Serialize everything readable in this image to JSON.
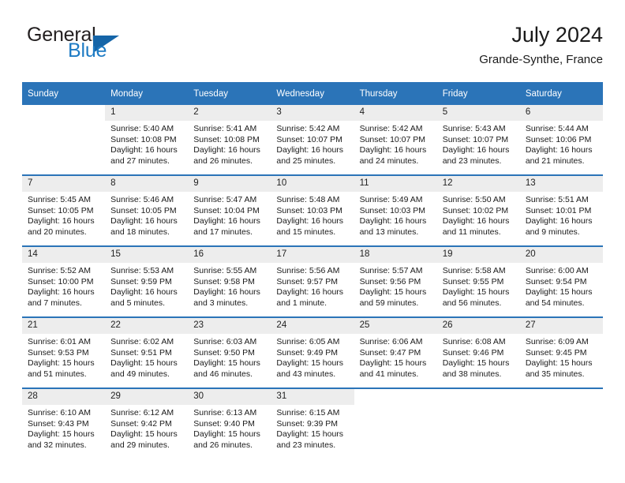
{
  "brand": {
    "name_part1": "General",
    "name_part2": "Blue",
    "flag_icon": "flag-icon",
    "accent_color": "#1e7bc4"
  },
  "header": {
    "title": "July 2024",
    "location": "Grande-Synthe, France"
  },
  "theme": {
    "header_blue": "#2b74b8",
    "daynum_gray": "#ededed",
    "text_color": "#1a1a1a"
  },
  "calendar": {
    "weekday_headers": [
      "Sunday",
      "Monday",
      "Tuesday",
      "Wednesday",
      "Thursday",
      "Friday",
      "Saturday"
    ],
    "weeks": [
      [
        {
          "day": "",
          "details": ""
        },
        {
          "day": "1",
          "details": "Sunrise: 5:40 AM\nSunset: 10:08 PM\nDaylight: 16 hours and 27 minutes."
        },
        {
          "day": "2",
          "details": "Sunrise: 5:41 AM\nSunset: 10:08 PM\nDaylight: 16 hours and 26 minutes."
        },
        {
          "day": "3",
          "details": "Sunrise: 5:42 AM\nSunset: 10:07 PM\nDaylight: 16 hours and 25 minutes."
        },
        {
          "day": "4",
          "details": "Sunrise: 5:42 AM\nSunset: 10:07 PM\nDaylight: 16 hours and 24 minutes."
        },
        {
          "day": "5",
          "details": "Sunrise: 5:43 AM\nSunset: 10:07 PM\nDaylight: 16 hours and 23 minutes."
        },
        {
          "day": "6",
          "details": "Sunrise: 5:44 AM\nSunset: 10:06 PM\nDaylight: 16 hours and 21 minutes."
        }
      ],
      [
        {
          "day": "7",
          "details": "Sunrise: 5:45 AM\nSunset: 10:05 PM\nDaylight: 16 hours and 20 minutes."
        },
        {
          "day": "8",
          "details": "Sunrise: 5:46 AM\nSunset: 10:05 PM\nDaylight: 16 hours and 18 minutes."
        },
        {
          "day": "9",
          "details": "Sunrise: 5:47 AM\nSunset: 10:04 PM\nDaylight: 16 hours and 17 minutes."
        },
        {
          "day": "10",
          "details": "Sunrise: 5:48 AM\nSunset: 10:03 PM\nDaylight: 16 hours and 15 minutes."
        },
        {
          "day": "11",
          "details": "Sunrise: 5:49 AM\nSunset: 10:03 PM\nDaylight: 16 hours and 13 minutes."
        },
        {
          "day": "12",
          "details": "Sunrise: 5:50 AM\nSunset: 10:02 PM\nDaylight: 16 hours and 11 minutes."
        },
        {
          "day": "13",
          "details": "Sunrise: 5:51 AM\nSunset: 10:01 PM\nDaylight: 16 hours and 9 minutes."
        }
      ],
      [
        {
          "day": "14",
          "details": "Sunrise: 5:52 AM\nSunset: 10:00 PM\nDaylight: 16 hours and 7 minutes."
        },
        {
          "day": "15",
          "details": "Sunrise: 5:53 AM\nSunset: 9:59 PM\nDaylight: 16 hours and 5 minutes."
        },
        {
          "day": "16",
          "details": "Sunrise: 5:55 AM\nSunset: 9:58 PM\nDaylight: 16 hours and 3 minutes."
        },
        {
          "day": "17",
          "details": "Sunrise: 5:56 AM\nSunset: 9:57 PM\nDaylight: 16 hours and 1 minute."
        },
        {
          "day": "18",
          "details": "Sunrise: 5:57 AM\nSunset: 9:56 PM\nDaylight: 15 hours and 59 minutes."
        },
        {
          "day": "19",
          "details": "Sunrise: 5:58 AM\nSunset: 9:55 PM\nDaylight: 15 hours and 56 minutes."
        },
        {
          "day": "20",
          "details": "Sunrise: 6:00 AM\nSunset: 9:54 PM\nDaylight: 15 hours and 54 minutes."
        }
      ],
      [
        {
          "day": "21",
          "details": "Sunrise: 6:01 AM\nSunset: 9:53 PM\nDaylight: 15 hours and 51 minutes."
        },
        {
          "day": "22",
          "details": "Sunrise: 6:02 AM\nSunset: 9:51 PM\nDaylight: 15 hours and 49 minutes."
        },
        {
          "day": "23",
          "details": "Sunrise: 6:03 AM\nSunset: 9:50 PM\nDaylight: 15 hours and 46 minutes."
        },
        {
          "day": "24",
          "details": "Sunrise: 6:05 AM\nSunset: 9:49 PM\nDaylight: 15 hours and 43 minutes."
        },
        {
          "day": "25",
          "details": "Sunrise: 6:06 AM\nSunset: 9:47 PM\nDaylight: 15 hours and 41 minutes."
        },
        {
          "day": "26",
          "details": "Sunrise: 6:08 AM\nSunset: 9:46 PM\nDaylight: 15 hours and 38 minutes."
        },
        {
          "day": "27",
          "details": "Sunrise: 6:09 AM\nSunset: 9:45 PM\nDaylight: 15 hours and 35 minutes."
        }
      ],
      [
        {
          "day": "28",
          "details": "Sunrise: 6:10 AM\nSunset: 9:43 PM\nDaylight: 15 hours and 32 minutes."
        },
        {
          "day": "29",
          "details": "Sunrise: 6:12 AM\nSunset: 9:42 PM\nDaylight: 15 hours and 29 minutes."
        },
        {
          "day": "30",
          "details": "Sunrise: 6:13 AM\nSunset: 9:40 PM\nDaylight: 15 hours and 26 minutes."
        },
        {
          "day": "31",
          "details": "Sunrise: 6:15 AM\nSunset: 9:39 PM\nDaylight: 15 hours and 23 minutes."
        },
        {
          "day": "",
          "details": ""
        },
        {
          "day": "",
          "details": ""
        },
        {
          "day": "",
          "details": ""
        }
      ]
    ]
  }
}
